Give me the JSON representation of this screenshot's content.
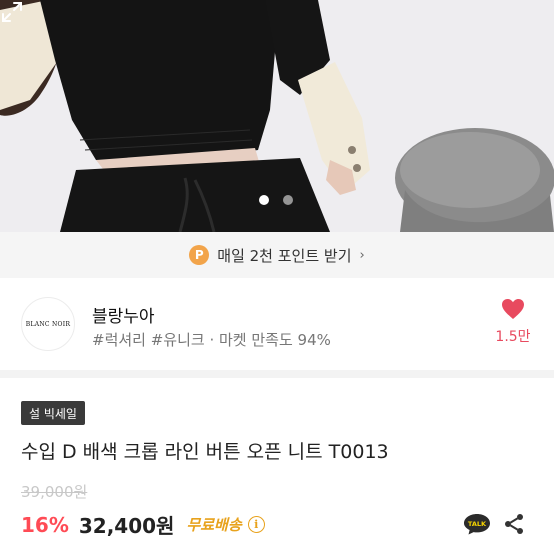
{
  "product_image": {
    "alt": "black cropped knit with cream sleeves",
    "slide_count": 2,
    "active_slide": 1,
    "icon": "expand-icon"
  },
  "point_banner": {
    "badge": "P",
    "text": "매일 2천 포인트 받기",
    "chevron": "›"
  },
  "shop": {
    "logo_text": "BLANC NOIR",
    "name": "블랑누아",
    "tags": "#럭셔리 #유니크 · 마켓 만족도 94%",
    "like_icon": "heart-icon",
    "like_count": "1.5만",
    "like_color": "#e84a5f"
  },
  "product": {
    "badge": "설 빅세일",
    "title": "수입 D 배색 크롭 라인 버튼 오픈 니트 T0013",
    "original_price": "39,000원",
    "discount": "16%",
    "price": "32,400원",
    "shipping": "무료배송",
    "info_icon": "i",
    "talk_label": "TALK",
    "share_icon": "share-icon",
    "discount_color": "#ff4b55",
    "shipping_color": "#e8a21c"
  }
}
